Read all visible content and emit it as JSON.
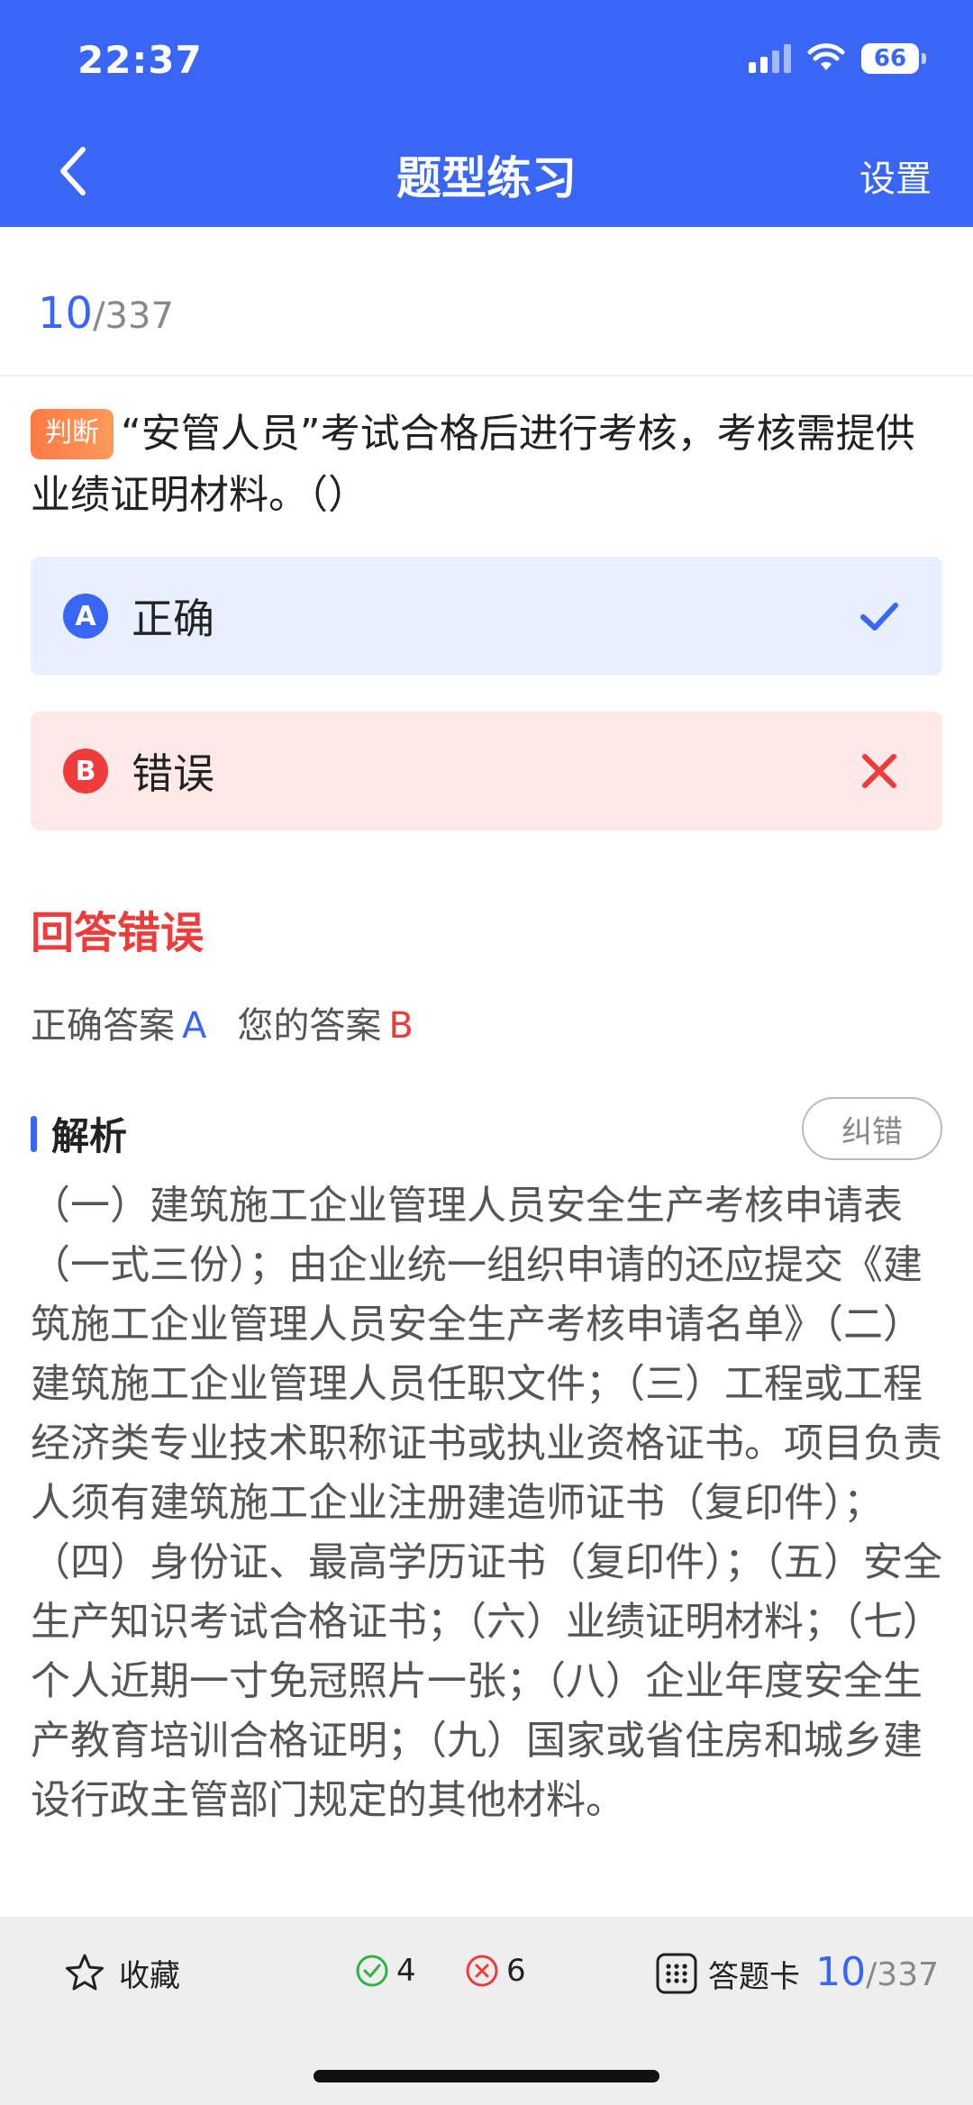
{
  "status": {
    "time": "22:37",
    "battery": "66"
  },
  "nav": {
    "title": "题型练习",
    "settings": "设置"
  },
  "progress": {
    "current": "10",
    "total": "/337"
  },
  "question": {
    "tag": "判断",
    "text": "“安管人员”考试合格后进行考核，考核需提供业绩证明材料。（）"
  },
  "options": [
    {
      "letter": "A",
      "label": "正确",
      "state": "correct"
    },
    {
      "letter": "B",
      "label": "错误",
      "state": "wrong"
    }
  ],
  "result": {
    "title": "回答错误",
    "correct_label": "正确答案",
    "correct_value": "A",
    "mine_label": "您的答案",
    "mine_value": "B"
  },
  "analysis": {
    "title": "解析",
    "report_button": "纠错",
    "body": "（一）建筑施工企业管理人员安全生产考核申请表（一式三份）；由企业统一组织申请的还应提交《建筑施工企业管理人员安全生产考核申请名单》（二）建筑施工企业管理人员任职文件；（三）工程或工程经济类专业技术职称证书或执业资格证书。项目负责人须有建筑施工企业注册建造师证书（复印件）；（四）身份证、最高学历证书（复印件）；（五）安全生产知识考试合格证书；（六）业绩证明材料；（七）个人近期一寸免冠照片一张；（八）企业年度安全生产教育培训合格证明；（九）国家或省住房和城乡建设行政主管部门规定的其他材料。"
  },
  "bottom": {
    "favorite": "收藏",
    "correct_count": "4",
    "wrong_count": "6",
    "answer_card": "答题卡",
    "current": "10",
    "total": "/337"
  },
  "colors": {
    "primary": "#3a66f5",
    "error": "#ee3b3b",
    "tag": "#ff7a45"
  }
}
